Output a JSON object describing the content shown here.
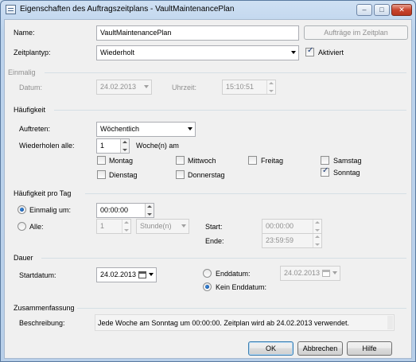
{
  "window": {
    "title": "Eigenschaften des Auftragszeitplans - VaultMaintenancePlan",
    "minimize_glyph": "–",
    "maximize_glyph": "□",
    "close_glyph": "✕"
  },
  "general": {
    "name_label": "Name:",
    "name_value": "VaultMaintenancePlan",
    "jobs_button": "Aufträge im Zeitplan",
    "schedule_type_label": "Zeitplantyp:",
    "schedule_type_value": "Wiederholt",
    "enabled_label": "Aktiviert",
    "enabled_checked": true
  },
  "once": {
    "heading": "Einmalig",
    "date_label": "Datum:",
    "date_value": "24.02.2013",
    "time_label": "Uhrzeit:",
    "time_value": "15:10:51"
  },
  "frequency": {
    "heading": "Häufigkeit",
    "occurs_label": "Auftreten:",
    "occurs_value": "Wöchentlich",
    "recurs_label": "Wiederholen alle:",
    "recurs_value": "1",
    "recurs_unit": "Woche(n) am",
    "days": [
      {
        "label": "Montag",
        "checked": false
      },
      {
        "label": "Mittwoch",
        "checked": false
      },
      {
        "label": "Freitag",
        "checked": false
      },
      {
        "label": "Samstag",
        "checked": false
      },
      {
        "label": "Dienstag",
        "checked": false
      },
      {
        "label": "Donnerstag",
        "checked": false
      },
      {
        "label": "Sonntag",
        "checked": true
      }
    ]
  },
  "daily": {
    "heading": "Häufigkeit pro Tag",
    "once_at_label": "Einmalig um:",
    "once_at_value": "00:00:00",
    "every_label": "Alle:",
    "every_value": "1",
    "every_unit": "Stunde(n)",
    "start_label": "Start:",
    "start_value": "00:00:00",
    "end_label": "Ende:",
    "end_value": "23:59:59",
    "selected": "once"
  },
  "duration": {
    "heading": "Dauer",
    "start_label": "Startdatum:",
    "start_value": "24.02.2013",
    "end_label": "Enddatum:",
    "end_value": "24.02.2013",
    "no_end_label": "Kein Enddatum:",
    "selected": "no_end"
  },
  "summary": {
    "heading": "Zusammenfassung",
    "description_label": "Beschreibung:",
    "description_value": "Jede Woche am Sonntag um 00:00:00. Zeitplan wird ab 24.02.2013 verwendet."
  },
  "buttons": {
    "ok": "OK",
    "cancel": "Abbrechen",
    "help": "Hilfe"
  }
}
